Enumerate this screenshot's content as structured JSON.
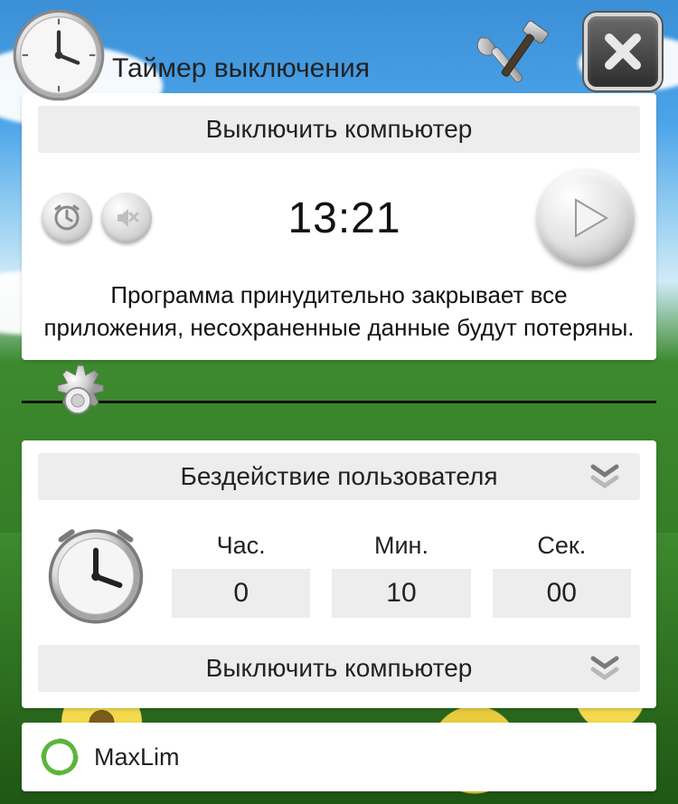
{
  "header": {
    "title": "Таймер выключения"
  },
  "top_card": {
    "action_label": "Выключить компьютер",
    "time_display": "13:21",
    "warning_text": "Программа принудительно закрывает все приложения, несохраненные данные будут потеряны."
  },
  "bottom_card": {
    "trigger_label": "Бездействие пользователя",
    "columns": {
      "hours": "Час.",
      "minutes": "Мин.",
      "seconds": "Сек."
    },
    "values": {
      "hours": "0",
      "minutes": "10",
      "seconds": "00"
    },
    "action_label": "Выключить компьютер"
  },
  "footer": {
    "brand": "MaxLim"
  },
  "icons": {
    "clock": "clock-icon",
    "tools": "tools-icon",
    "close": "close-icon",
    "schedule": "schedule-icon",
    "mute": "mute-icon",
    "play": "play-icon",
    "gear": "gear-icon",
    "chevron": "chevron-down-icon",
    "brand": "brand-icon"
  }
}
